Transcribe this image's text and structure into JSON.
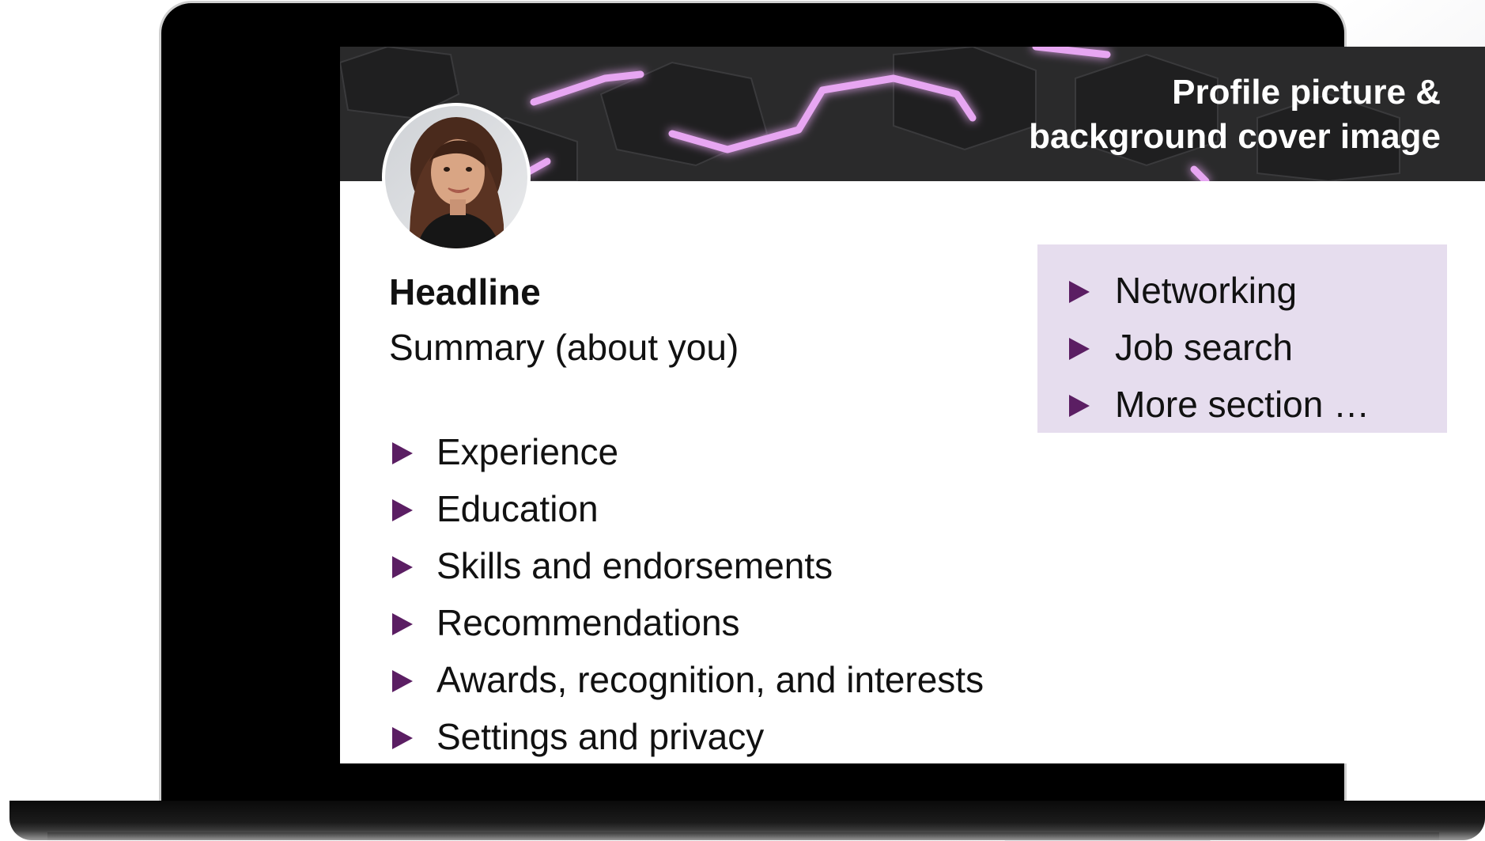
{
  "cover": {
    "title_line1": "Profile picture &",
    "title_line2": "background cover image",
    "accent_color": "#b04cc6",
    "background_color": "#2a2a2b"
  },
  "profile": {
    "headline": "Headline",
    "summary": "Summary (about you)"
  },
  "main_sections": [
    {
      "label": "Experience",
      "icon": "triangle-bullet-icon"
    },
    {
      "label": "Education",
      "icon": "triangle-bullet-icon"
    },
    {
      "label": "Skills and endorsements",
      "icon": "triangle-bullet-icon"
    },
    {
      "label": "Recommendations",
      "icon": "triangle-bullet-icon"
    },
    {
      "label": "Awards, recognition, and interests",
      "icon": "triangle-bullet-icon"
    },
    {
      "label": "Settings and privacy",
      "icon": "triangle-bullet-icon"
    }
  ],
  "side_sections": [
    {
      "label": "Networking",
      "icon": "triangle-bullet-icon"
    },
    {
      "label": "Job search",
      "icon": "triangle-bullet-icon"
    },
    {
      "label": "More section …",
      "icon": "triangle-bullet-icon"
    }
  ],
  "colors": {
    "bullet": "#5b1e63",
    "side_box": "#e6ddee",
    "text": "#111111"
  }
}
